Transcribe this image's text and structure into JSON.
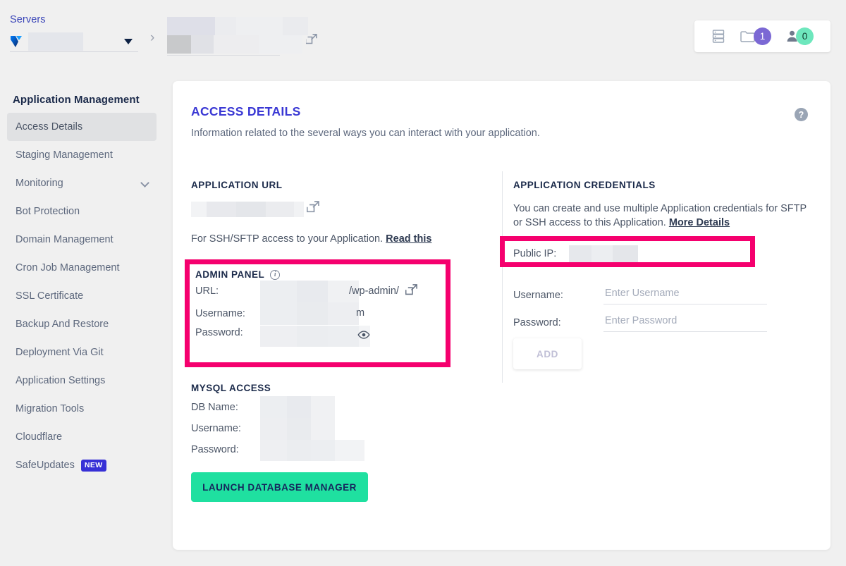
{
  "topbar": {
    "server_label": "Servers",
    "server_value": "",
    "logo": "vultr-logo",
    "breadcrumb_app": "",
    "counters": [
      {
        "icon": "server-stack-icon",
        "value": ""
      },
      {
        "icon": "folder-icon",
        "value": "1",
        "color": "#7b68d4"
      },
      {
        "icon": "user-icon",
        "value": "0",
        "color": "#6ee7bd"
      }
    ]
  },
  "sidebar": {
    "title": "Application Management",
    "items": [
      {
        "label": "Access Details",
        "active": true
      },
      {
        "label": "Staging Management",
        "active": false
      },
      {
        "label": "Monitoring",
        "active": false,
        "expandable": true
      },
      {
        "label": "Bot Protection",
        "active": false
      },
      {
        "label": "Domain Management",
        "active": false
      },
      {
        "label": "Cron Job Management",
        "active": false
      },
      {
        "label": "SSL Certificate",
        "active": false
      },
      {
        "label": "Backup And Restore",
        "active": false
      },
      {
        "label": "Deployment Via Git",
        "active": false
      },
      {
        "label": "Application Settings",
        "active": false
      },
      {
        "label": "Migration Tools",
        "active": false
      },
      {
        "label": "Cloudflare",
        "active": false
      },
      {
        "label": "SafeUpdates",
        "active": false,
        "badge": "NEW"
      }
    ]
  },
  "card": {
    "title": "ACCESS DETAILS",
    "subtitle": "Information related to the several ways you can interact with your application.",
    "help_icon": "question-mark-icon"
  },
  "application_url": {
    "heading": "APPLICATION URL",
    "value": "",
    "external_icon": "external-link-icon",
    "note_text": "For SSH/SFTP access to your Application.",
    "note_link": "Read this"
  },
  "admin_panel": {
    "heading": "ADMIN PANEL",
    "info_icon": "info-icon",
    "url_label": "URL:",
    "url_value": "",
    "url_suffix": "/wp-admin/",
    "url_external_icon": "external-link-icon",
    "username_label": "Username:",
    "username_value": "",
    "username_suffix": "m",
    "password_label": "Password:",
    "password_value": "",
    "password_reveal_icon": "eye-icon",
    "highlight_color": "#f5006e"
  },
  "mysql_access": {
    "heading": "MYSQL ACCESS",
    "db_name_label": "DB Name:",
    "db_name_value": "",
    "username_label": "Username:",
    "username_value": "",
    "password_label": "Password:",
    "password_value": "",
    "launch_button": "LAUNCH DATABASE MANAGER",
    "launch_button_color": "#1fe0a0"
  },
  "application_credentials": {
    "heading": "APPLICATION CREDENTIALS",
    "note_line1": "You can create and use multiple Application credentials for SFTP",
    "note_line2": "or SSH access to this Application.",
    "note_link": "More Details",
    "public_ip_label": "Public IP:",
    "public_ip_value": "",
    "highlight_color": "#f5006e",
    "username_label": "Username:",
    "username_placeholder": "Enter Username",
    "username_value": "",
    "password_label": "Password:",
    "password_placeholder": "Enter Password",
    "password_value": "",
    "add_button": "ADD"
  }
}
